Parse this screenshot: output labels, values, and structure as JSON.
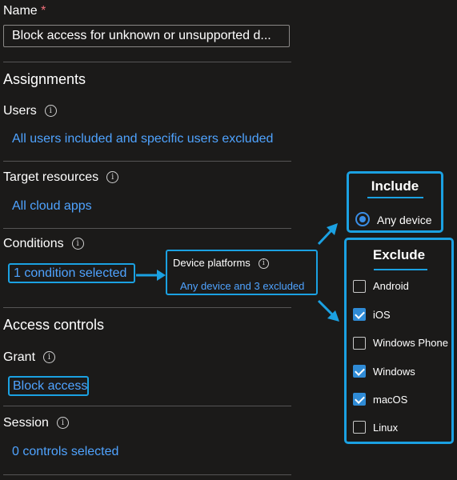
{
  "form": {
    "name_label": "Name",
    "required_mark": "*",
    "name_value": "Block access for unknown or unsupported d...",
    "assignments_heading": "Assignments",
    "users_label": "Users",
    "users_link": "All users included and specific users excluded",
    "target_label": "Target resources",
    "target_link": "All cloud apps",
    "conditions_label": "Conditions",
    "conditions_link": "1 condition selected",
    "access_heading": "Access controls",
    "grant_label": "Grant",
    "grant_link": "Block access",
    "session_label": "Session",
    "session_link": "0 controls selected"
  },
  "device_platforms": {
    "title": "Device platforms",
    "summary": "Any device and 3 excluded"
  },
  "include_panel": {
    "title": "Include",
    "option": "Any device",
    "selected": true
  },
  "exclude_panel": {
    "title": "Exclude",
    "platforms": [
      {
        "label": "Android",
        "checked": false
      },
      {
        "label": "iOS",
        "checked": true
      },
      {
        "label": "Windows Phone",
        "checked": false
      },
      {
        "label": "Windows",
        "checked": true
      },
      {
        "label": "macOS",
        "checked": true
      },
      {
        "label": "Linux",
        "checked": false
      }
    ]
  },
  "colors": {
    "accent": "#1ba1e2",
    "link": "#4fa3ff",
    "required": "#f1707b",
    "background": "#1b1a19"
  },
  "icons": {
    "info": "info-icon",
    "arrow": "arrow-icon"
  }
}
